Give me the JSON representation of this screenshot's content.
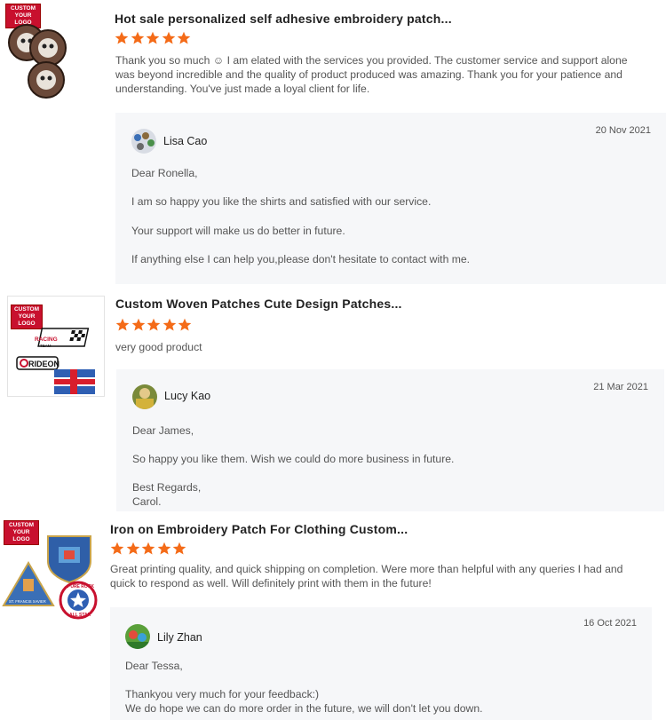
{
  "star_color": "#f46b18",
  "reviews": [
    {
      "badge": [
        "CUSTOM",
        "YOUR LOGO"
      ],
      "product_title": "Hot sale personalized self adhesive embroidery patch...",
      "rating": 5,
      "text": [
        "Thank you so much ☺ I am elated with the services you provided. The customer service and support alone",
        "was beyond incredible and the quality of product produced was amazing. Thank you for your patience and",
        "understanding. You've just made a loyal client for life."
      ],
      "reply": {
        "seller": "Lisa Cao",
        "date": "20 Nov 2021",
        "lines": [
          "Dear Ronella,",
          "I am so happy you like the shirts and satisfied with our service.",
          "Your support will make us do better in future.",
          "If anything else I can help you,please don't hesitate to contact with me."
        ]
      }
    },
    {
      "badge": [
        "CUSTOM",
        "YOUR LOGO"
      ],
      "product_title": "Custom Woven Patches Cute Design Patches...",
      "rating": 5,
      "text": [
        "very good product"
      ],
      "patch_texts": [
        "RACING",
        "TEAM",
        "RIDEON"
      ],
      "reply": {
        "seller": "Lucy Kao",
        "date": "21 Mar 2021",
        "lines": [
          "Dear James,",
          "So happy you like them. Wish we could do more business in future.",
          "Best Regards,",
          "Carol."
        ]
      }
    },
    {
      "badge": [
        "CUSTOM",
        "YOUR LOGO"
      ],
      "product_title": "Iron on Embroidery Patch For Clothing Custom...",
      "rating": 5,
      "text": [
        "Great printing quality, and quick shipping on completion. Were more than helpful with any queries I had and",
        "quick to respond as well. Will definitely print with them in the future!"
      ],
      "patch_texts": [
        "ST. FRANCIS XAVIER",
        "PURE ROCK",
        "ALL STAR"
      ],
      "reply": {
        "seller": "Lily Zhan",
        "date": "16 Oct 2021",
        "lines": [
          "Dear Tessa,",
          "Thankyou very much for your feedback:)",
          "We do hope we can do more order in the future, we will don't let you down."
        ]
      }
    }
  ]
}
